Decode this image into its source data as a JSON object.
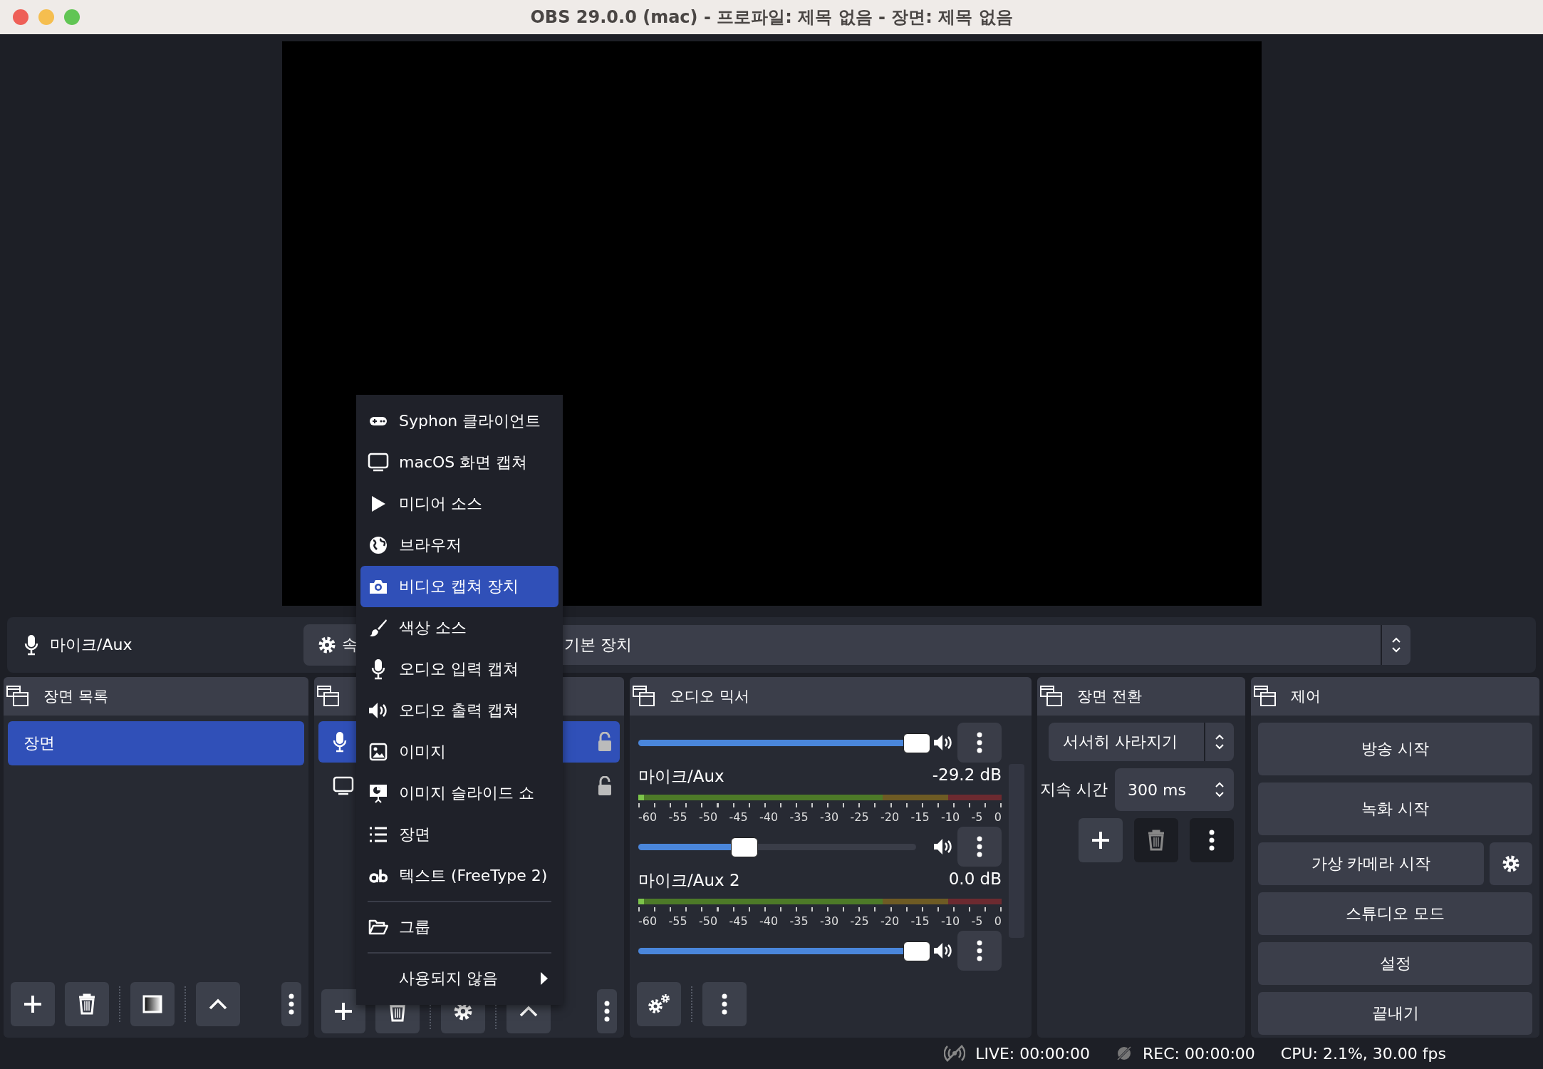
{
  "window": {
    "title": "OBS 29.0.0 (mac) - 프로파일: 제목 없음 - 장면: 제목 없음"
  },
  "properties_bar": {
    "source_name": "마이크/Aux",
    "properties_button": "속",
    "device": "기본 장치"
  },
  "scenes": {
    "title": "장면 목록",
    "items": [
      {
        "name": "장면",
        "selected": true
      }
    ],
    "toolbar": [
      {
        "kind": "add"
      },
      {
        "kind": "remove"
      },
      {
        "kind": "separator"
      },
      {
        "kind": "filter"
      },
      {
        "kind": "separator"
      },
      {
        "kind": "up"
      },
      {
        "kind": "menu"
      }
    ]
  },
  "sources": {
    "items": [
      {
        "kind": "audio",
        "selected": true
      },
      {
        "kind": "display",
        "selected": false
      }
    ],
    "toolbar": [
      {
        "kind": "add"
      },
      {
        "kind": "remove"
      },
      {
        "kind": "separator"
      },
      {
        "kind": "settings"
      },
      {
        "kind": "separator"
      },
      {
        "kind": "up"
      },
      {
        "kind": "menu"
      }
    ]
  },
  "audio_mixer": {
    "title": "오디오 믹서",
    "channels": [
      {
        "level": 1.0
      },
      {
        "name": "마이크/Aux",
        "reading": "-29.2 dB",
        "scale": [
          "-60",
          "-55",
          "-50",
          "-45",
          "-40",
          "-35",
          "-30",
          "-25",
          "-20",
          "-15",
          "-10",
          "-5",
          "0"
        ],
        "level": 0.38
      },
      {
        "name": "마이크/Aux 2",
        "reading": "0.0 dB",
        "scale": [
          "-60",
          "-55",
          "-50",
          "-45",
          "-40",
          "-35",
          "-30",
          "-25",
          "-20",
          "-15",
          "-10",
          "-5",
          "0"
        ],
        "level": 1.0
      }
    ],
    "toolbar": [
      {
        "kind": "mixer-settings"
      },
      {
        "kind": "separator"
      },
      {
        "kind": "menu"
      }
    ]
  },
  "scene_transitions": {
    "title": "장면 전환",
    "transition": "서서히 사라지기",
    "duration_label": "지속 시간",
    "duration": "300 ms",
    "buttons": [
      {
        "kind": "add",
        "disabled": false
      },
      {
        "kind": "remove",
        "disabled": true
      },
      {
        "kind": "menu",
        "disabled": true
      }
    ]
  },
  "controls": {
    "title": "제어",
    "buttons": [
      {
        "label": "방송 시작",
        "has_settings": false
      },
      {
        "label": "녹화 시작",
        "has_settings": false
      },
      {
        "label": "가상 카메라 시작",
        "has_settings": true
      },
      {
        "label": "스튜디오 모드",
        "has_settings": false
      },
      {
        "label": "설정",
        "has_settings": false
      },
      {
        "label": "끝내기",
        "has_settings": false
      }
    ]
  },
  "status_bar": {
    "live": "LIVE: 00:00:00",
    "rec": "REC: 00:00:00",
    "cpu": "CPU: 2.1%, 30.00 fps"
  },
  "context_menu": {
    "items": [
      {
        "kind": "syphon",
        "label": "Syphon 클라이언트",
        "selected": false
      },
      {
        "kind": "display",
        "label": "macOS 화면 캡쳐",
        "selected": false
      },
      {
        "kind": "media",
        "label": "미디어 소스",
        "selected": false
      },
      {
        "kind": "browser",
        "label": "브라우저",
        "selected": false
      },
      {
        "kind": "camera",
        "label": "비디오 캡쳐 장치",
        "selected": true
      },
      {
        "kind": "color",
        "label": "색상 소스",
        "selected": false
      },
      {
        "kind": "audio-in",
        "label": "오디오 입력 캡쳐",
        "selected": false
      },
      {
        "kind": "audio-out",
        "label": "오디오 출력 캡쳐",
        "selected": false
      },
      {
        "kind": "image",
        "label": "이미지",
        "selected": false
      },
      {
        "kind": "slideshow",
        "label": "이미지 슬라이드 쇼",
        "selected": false
      },
      {
        "kind": "scene",
        "label": "장면",
        "selected": false
      },
      {
        "kind": "text",
        "label": "텍스트 (FreeType 2)",
        "selected": false
      },
      {
        "kind": "separator"
      },
      {
        "kind": "group",
        "label": "그룹",
        "selected": false
      },
      {
        "kind": "separator"
      },
      {
        "kind": "deprecated",
        "label": "사용되지 않음",
        "selected": false,
        "has_submenu": true
      }
    ]
  }
}
